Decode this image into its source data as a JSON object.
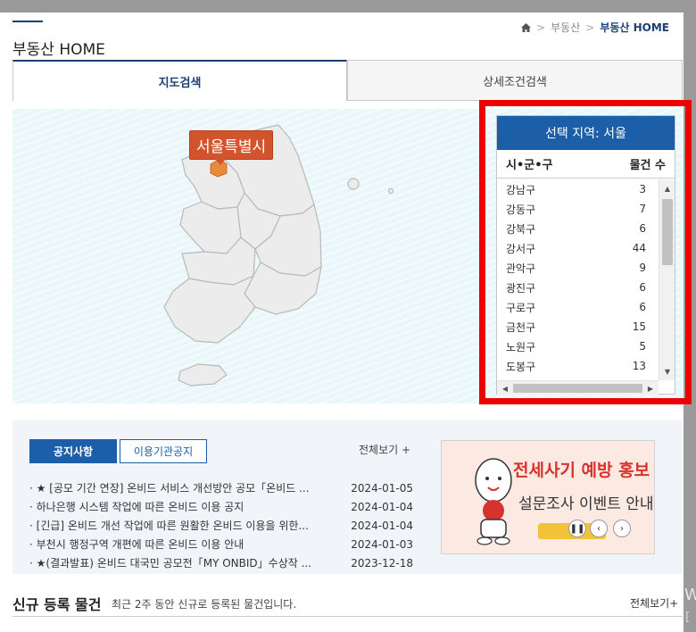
{
  "breadcrumb": {
    "items": [
      "부동산",
      "부동산 HOME"
    ]
  },
  "page": {
    "title": "부동산 HOME"
  },
  "tabs": [
    {
      "label": "지도검색"
    },
    {
      "label": "상세조건검색"
    }
  ],
  "map": {
    "tooltip": "서울특별시"
  },
  "region_panel": {
    "header": "선택 지역: 서울",
    "col_region": "시•군•구",
    "col_count": "물건 수",
    "rows": [
      {
        "name": "강남구",
        "count": "3"
      },
      {
        "name": "강동구",
        "count": "7"
      },
      {
        "name": "강북구",
        "count": "6"
      },
      {
        "name": "강서구",
        "count": "44"
      },
      {
        "name": "관악구",
        "count": "9"
      },
      {
        "name": "광진구",
        "count": "6"
      },
      {
        "name": "구로구",
        "count": "6"
      },
      {
        "name": "금천구",
        "count": "15"
      },
      {
        "name": "노원구",
        "count": "5"
      },
      {
        "name": "도봉구",
        "count": "13"
      }
    ]
  },
  "notices": {
    "tabs": [
      "공지사항",
      "이용기관공지"
    ],
    "view_all": "전체보기 +",
    "items": [
      {
        "title": "★ [공모 기간 연장] 온비드 서비스 개선방안 공모「온비드 ...",
        "date": "2024-01-05"
      },
      {
        "title": "하나은행 시스템 작업에 따른 온비드 이용 공지",
        "date": "2024-01-04"
      },
      {
        "title": "[긴급] 온비드 개선 작업에 따른 원활한 온비드 이용을 위한...",
        "date": "2024-01-04"
      },
      {
        "title": "부천시 행정구역 개편에 따른 온비드 이용 안내",
        "date": "2024-01-03"
      },
      {
        "title": "★(결과발표) 온비드 대국민 공모전「MY ONBID」수상작 ...",
        "date": "2023-12-18"
      }
    ]
  },
  "banner": {
    "line1": "전세사기 예방 홍보",
    "line2": "설문조사 이벤트 안내"
  },
  "new_listings": {
    "title": "신규 등록 물건",
    "subtitle": "최근 2주 동안 신규로 등록된 물건입니다.",
    "view_all": "전체보기+"
  },
  "colors": {
    "brand_navy": "#1c3f73",
    "panel_blue": "#1d5ea8",
    "highlight_red": "#ee0000",
    "tooltip_orange": "#d2542d",
    "seoul_orange": "#e88a3c"
  },
  "icons": {
    "home": "home-icon"
  }
}
